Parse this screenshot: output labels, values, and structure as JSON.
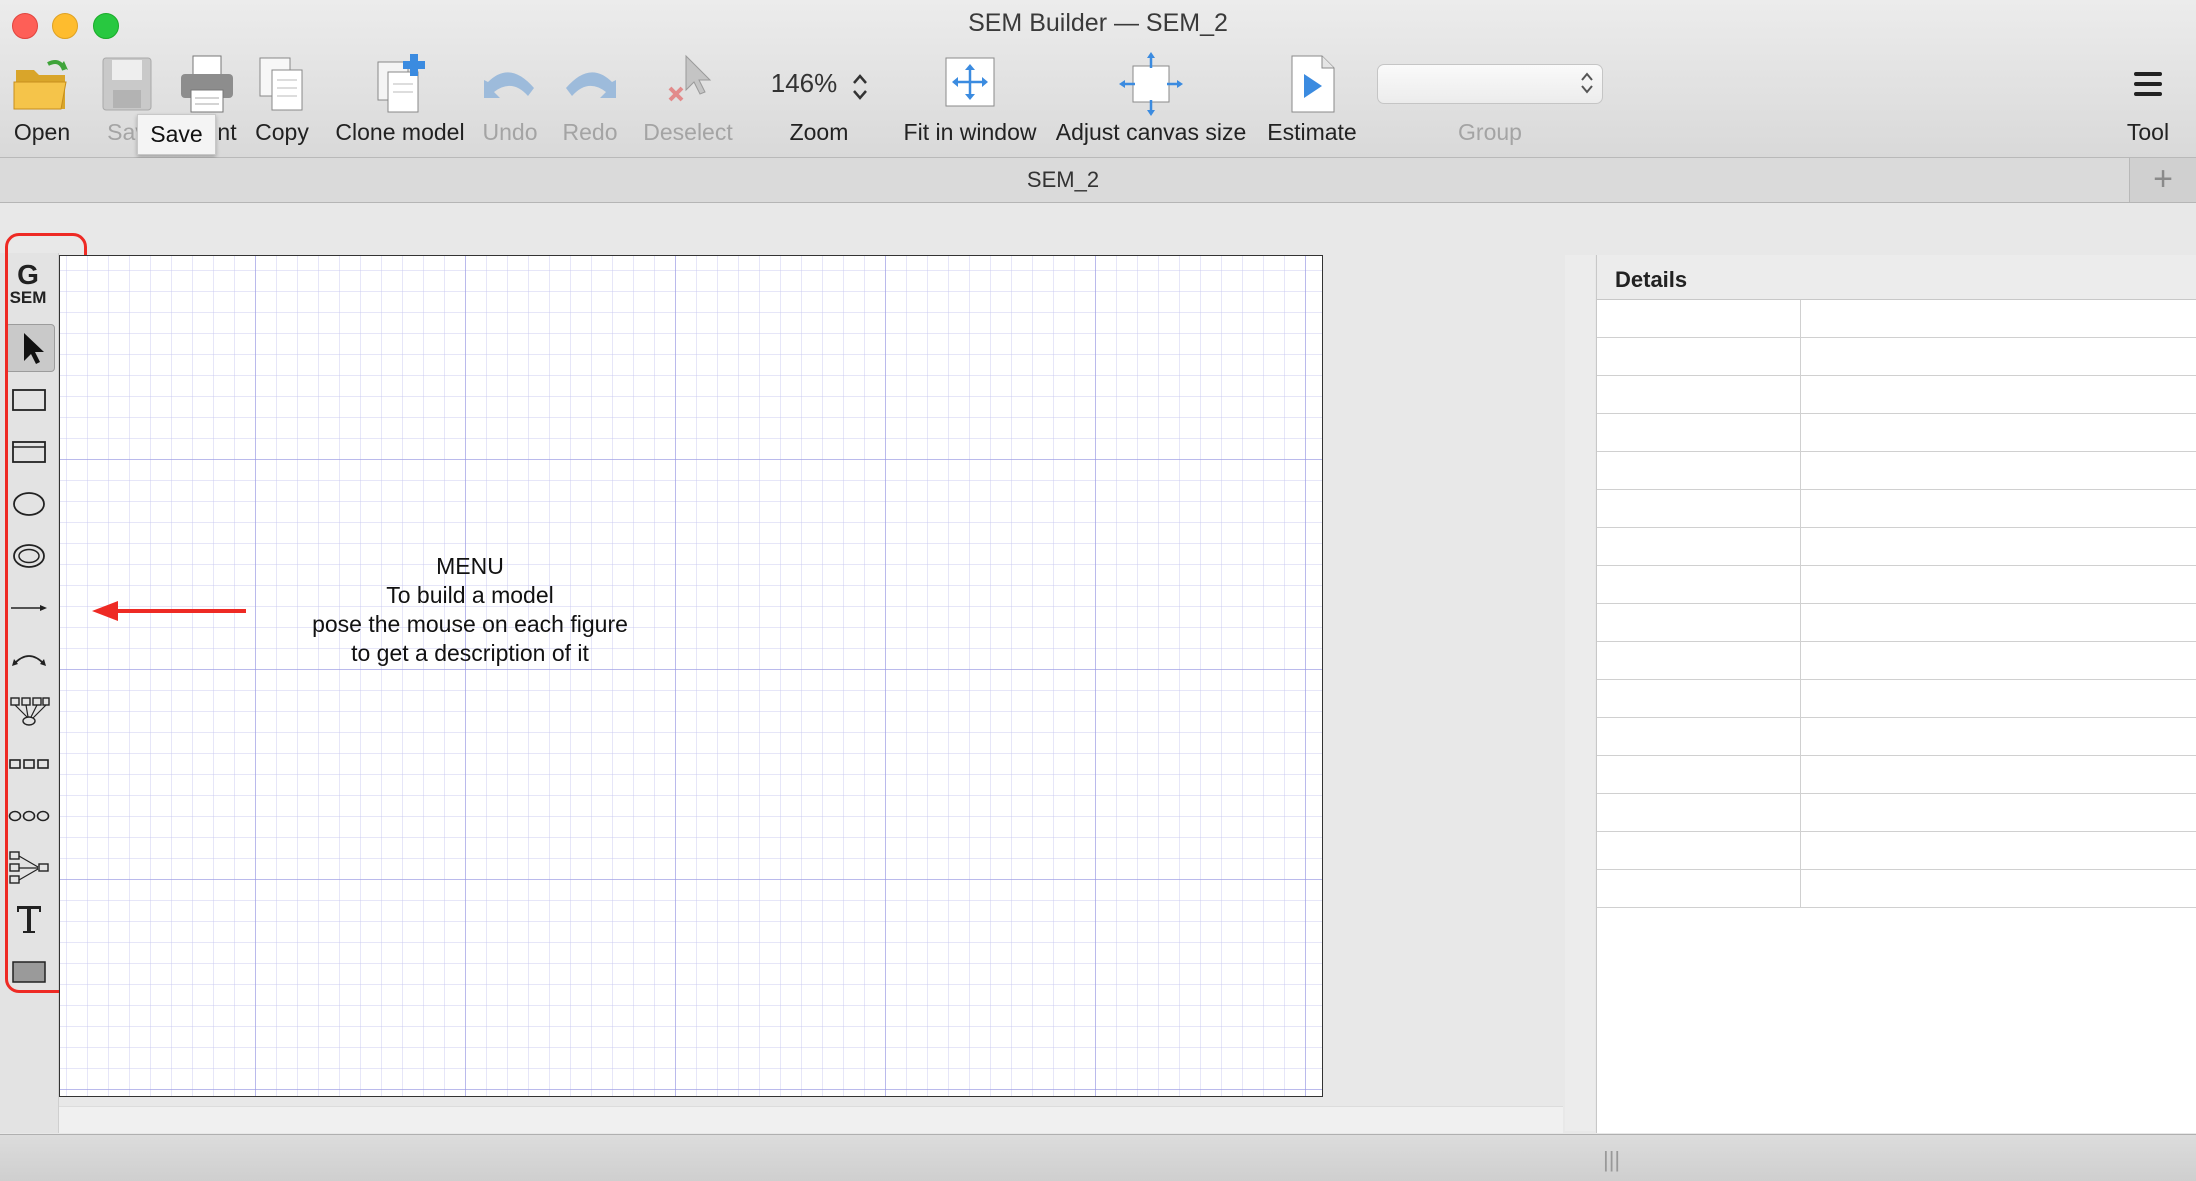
{
  "window": {
    "title": "SEM Builder — SEM_2"
  },
  "toolbar": {
    "open": "Open",
    "save": "Sav",
    "print": "nt",
    "copy": "Copy",
    "clone": "Clone model",
    "undo": "Undo",
    "redo": "Redo",
    "deselect": "Deselect",
    "zoom_value": "146%",
    "zoom": "Zoom",
    "fit": "Fit in window",
    "adjust": "Adjust canvas size",
    "estimate": "Estimate",
    "group": "Group",
    "tool": "Tool",
    "tooltip": "Save"
  },
  "tabs": {
    "active": "SEM_2",
    "add": "+"
  },
  "palette": {
    "logo_top": "G",
    "logo_bottom": "SEM",
    "tools": [
      "select-icon",
      "observed-variable-icon",
      "generalized-response-icon",
      "latent-variable-icon",
      "multilevel-latent-icon",
      "path-icon",
      "covariance-icon",
      "measurement-component-icon",
      "observed-set-icon",
      "latent-set-icon",
      "regression-component-icon",
      "text-icon",
      "area-icon"
    ]
  },
  "canvas": {
    "note": [
      "MENU",
      "To build a model",
      "pose the mouse on each figure",
      "to get a description of it"
    ]
  },
  "details": {
    "title": "Details",
    "rows": 16
  },
  "colors": {
    "annotation": "#ee2a24",
    "grid_major": "#9696e1",
    "grid_minor": "#c8c8f0"
  }
}
